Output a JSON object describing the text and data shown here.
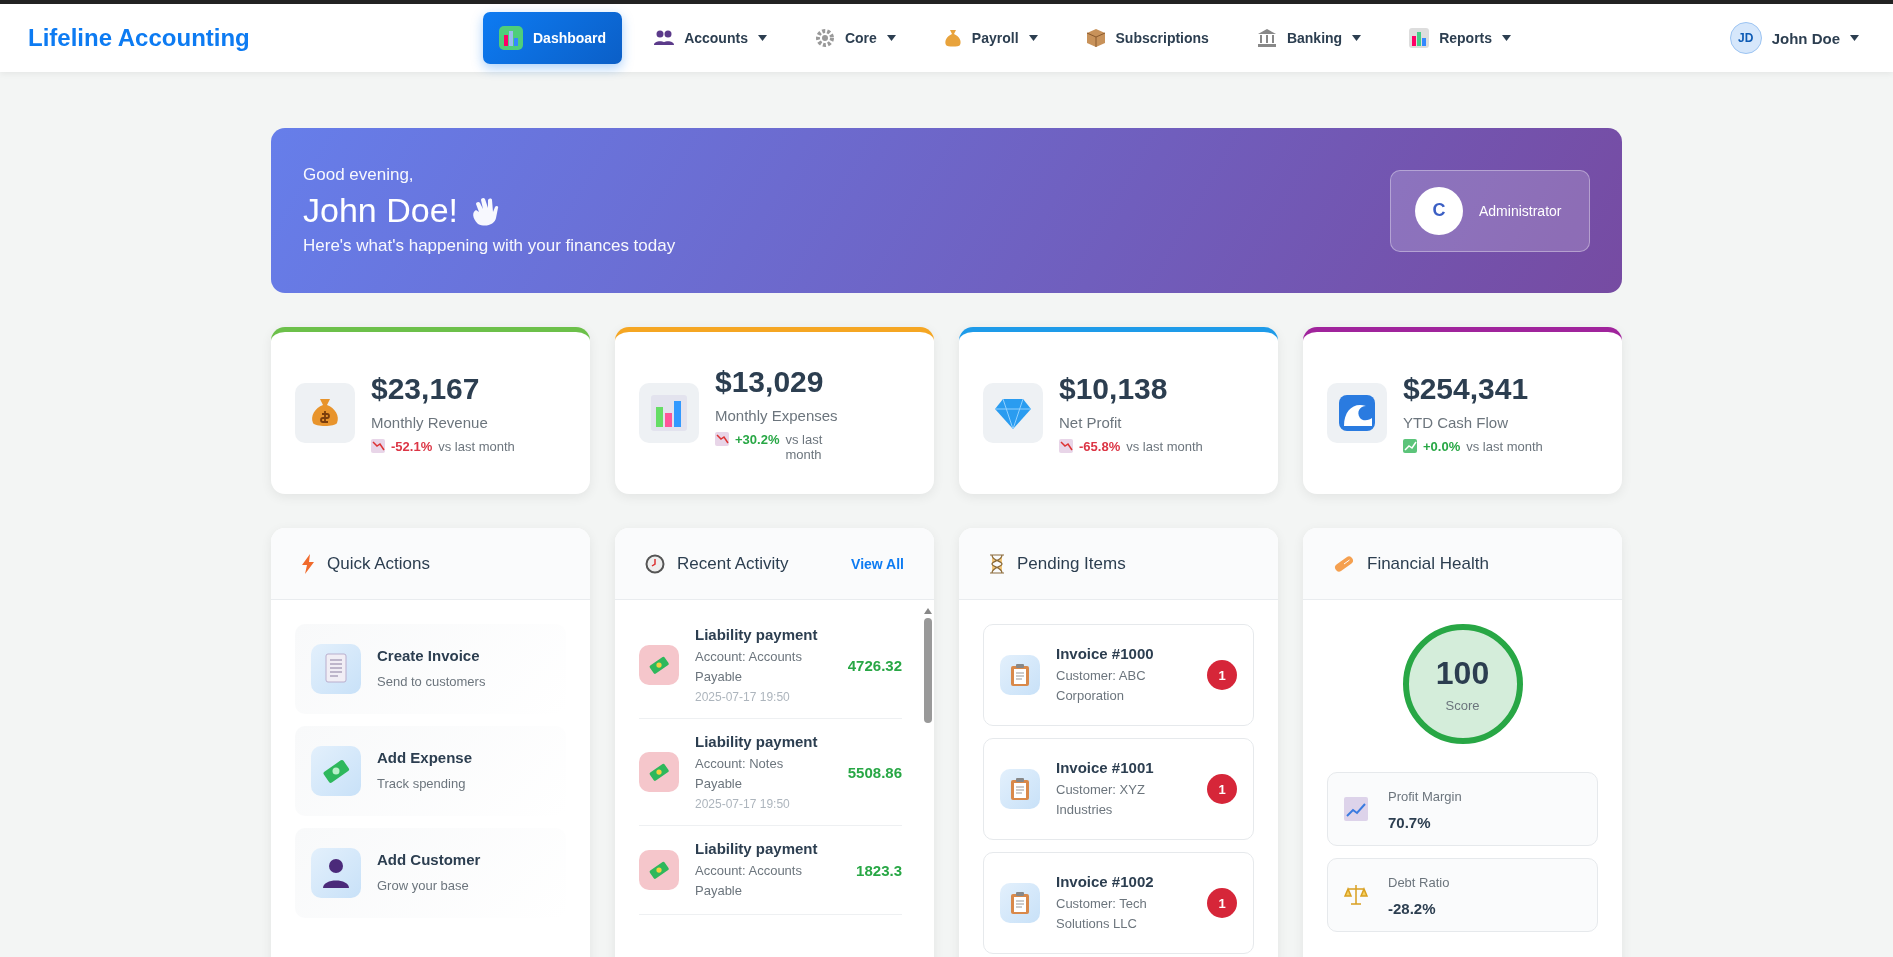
{
  "brand": "Lifeline Accounting",
  "nav": [
    {
      "label": "Dashboard",
      "selected": true,
      "dropdown": false
    },
    {
      "label": "Accounts",
      "selected": false,
      "dropdown": true
    },
    {
      "label": "Core",
      "selected": false,
      "dropdown": true
    },
    {
      "label": "Payroll",
      "selected": false,
      "dropdown": true
    },
    {
      "label": "Subscriptions",
      "selected": false,
      "dropdown": false
    },
    {
      "label": "Banking",
      "selected": false,
      "dropdown": true
    },
    {
      "label": "Reports",
      "selected": false,
      "dropdown": true
    }
  ],
  "user": {
    "initials": "JD",
    "name": "John Doe"
  },
  "hero": {
    "greeting": "Good evening,",
    "name": "John Doe!",
    "subtitle": "Here's what's happening with your finances today",
    "role_initial": "C",
    "role": "Administrator"
  },
  "stats": [
    {
      "value": "$23,167",
      "label": "Monthly Revenue",
      "change": "-52.1%",
      "kind": "down",
      "suffix": "vs last month",
      "color": "#6cc04a"
    },
    {
      "value": "$13,029",
      "label": "Monthly Expenses",
      "change": "+30.2%",
      "kind": "down",
      "suffix": "vs last month",
      "color": "#f5a623"
    },
    {
      "value": "$10,138",
      "label": "Net Profit",
      "change": "-65.8%",
      "kind": "down",
      "suffix": "vs last month",
      "color": "#1e9be9"
    },
    {
      "value": "$254,341",
      "label": "YTD Cash Flow",
      "change": "+0.0%",
      "kind": "up",
      "suffix": "vs last month",
      "color": "#a0249c"
    }
  ],
  "quick_actions": {
    "title": "Quick Actions",
    "items": [
      {
        "title": "Create Invoice",
        "subtitle": "Send to customers"
      },
      {
        "title": "Add Expense",
        "subtitle": "Track spending"
      },
      {
        "title": "Add Customer",
        "subtitle": "Grow your base"
      }
    ]
  },
  "recent_activity": {
    "title": "Recent Activity",
    "link": "View All",
    "items": [
      {
        "title": "Liability payment",
        "account": "Account: Accounts Payable",
        "date": "2025-07-17 19:50",
        "amount": "4726.32"
      },
      {
        "title": "Liability payment",
        "account": "Account: Notes Payable",
        "date": "2025-07-17 19:50",
        "amount": "5508.86"
      },
      {
        "title": "Liability payment",
        "account": "Account: Accounts Payable",
        "amount": "1823.3"
      }
    ]
  },
  "pending": {
    "title": "Pending Items",
    "items": [
      {
        "title": "Invoice #1000",
        "subtitle": "Customer: ABC Corporation",
        "count": "1"
      },
      {
        "title": "Invoice #1001",
        "subtitle": "Customer: XYZ Industries",
        "count": "1"
      },
      {
        "title": "Invoice #1002",
        "subtitle": "Customer: Tech Solutions LLC",
        "count": "1"
      }
    ]
  },
  "health": {
    "title": "Financial Health",
    "score": "100",
    "score_label": "Score",
    "metrics": [
      {
        "label": "Profit Margin",
        "value": "70.7%"
      },
      {
        "label": "Debt Ratio",
        "value": "-28.2%"
      }
    ]
  }
}
